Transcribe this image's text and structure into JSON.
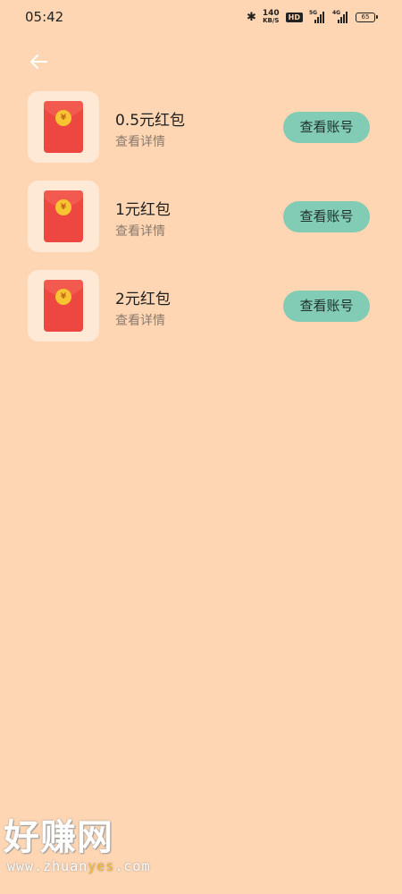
{
  "status_bar": {
    "time": "05:42",
    "net_speed_value": "140",
    "net_speed_unit": "KB/S",
    "hd_label": "HD",
    "signal_1_label": "5G",
    "signal_2_label": "4G",
    "battery": "65"
  },
  "items": [
    {
      "title": "0.5元红包",
      "subtitle": "查看详情",
      "button": "查看账号",
      "coin": "¥"
    },
    {
      "title": "1元红包",
      "subtitle": "查看详情",
      "button": "查看账号",
      "coin": "¥"
    },
    {
      "title": "2元红包",
      "subtitle": "查看详情",
      "button": "查看账号",
      "coin": "¥"
    }
  ],
  "watermark": {
    "name": "好赚网",
    "url_prefix": "www.zhuan",
    "url_highlight": "yes",
    "url_suffix": ".com"
  },
  "colors": {
    "background": "#FED6B3",
    "button": "#82CBB4",
    "envelope": "#EE4640",
    "coin": "#F7C531"
  }
}
